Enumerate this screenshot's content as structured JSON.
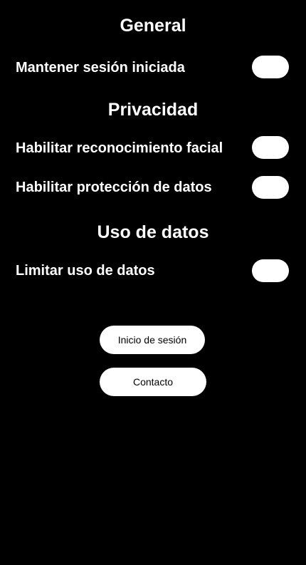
{
  "sections": {
    "general": {
      "title": "General",
      "settings": [
        {
          "label": "Mantener sesión iniciada",
          "enabled": false
        }
      ]
    },
    "privacy": {
      "title": "Privacidad",
      "settings": [
        {
          "label": "Habilitar reconocimiento facial",
          "enabled": false
        },
        {
          "label": "Habilitar protección de datos",
          "enabled": false
        }
      ]
    },
    "data_usage": {
      "title": "Uso de datos",
      "settings": [
        {
          "label": "Limitar uso de datos",
          "enabled": false
        }
      ]
    }
  },
  "buttons": {
    "login_label": "Inicio de sesión",
    "contact_label": "Contacto"
  },
  "colors": {
    "background": "#000000",
    "foreground": "#ffffff",
    "button_text": "#000000"
  }
}
